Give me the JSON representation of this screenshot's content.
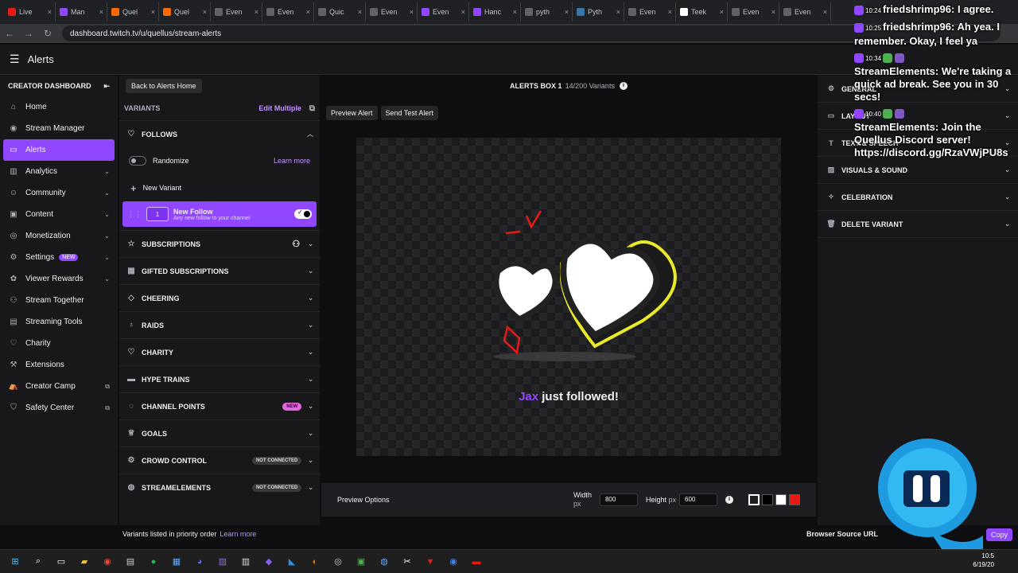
{
  "browser": {
    "tabs": [
      "Live",
      "Man",
      "Quel",
      "Quel",
      "Even",
      "Even",
      "Quic",
      "Even",
      "Even",
      "Hanc",
      "pyth",
      "Pyth",
      "Even",
      "Teek",
      "Even",
      "Even"
    ],
    "url": "dashboard.twitch.tv/u/quellus/stream-alerts"
  },
  "header": {
    "title": "Alerts"
  },
  "sidebar": {
    "heading": "CREATOR DASHBOARD",
    "items": [
      {
        "label": "Home",
        "icon": "⌂"
      },
      {
        "label": "Stream Manager",
        "icon": "◉"
      },
      {
        "label": "Alerts",
        "icon": "▭",
        "active": true
      },
      {
        "label": "Analytics",
        "icon": "▥",
        "chevron": true
      },
      {
        "label": "Community",
        "icon": "☺",
        "chevron": true
      },
      {
        "label": "Content",
        "icon": "▣",
        "chevron": true
      },
      {
        "label": "Monetization",
        "icon": "◎",
        "chevron": true
      },
      {
        "label": "Settings",
        "icon": "⚙",
        "chevron": true,
        "badge": "NEW"
      },
      {
        "label": "Viewer Rewards",
        "icon": "✿",
        "chevron": true
      },
      {
        "label": "Stream Together",
        "icon": "⚇"
      },
      {
        "label": "Streaming Tools",
        "icon": "▤"
      },
      {
        "label": "Charity",
        "icon": "♡"
      },
      {
        "label": "Extensions",
        "icon": "⚒"
      },
      {
        "label": "Creator Camp",
        "icon": "⛺",
        "external": true
      },
      {
        "label": "Safety Center",
        "icon": "⛉",
        "external": true
      }
    ]
  },
  "variants": {
    "back_label": "Back to Alerts Home",
    "label": "VARIANTS",
    "edit_multiple": "Edit Multiple",
    "follows": "FOLLOWS",
    "randomize": "Randomize",
    "learn_more": "Learn more",
    "new_variant": "New Variant",
    "card": {
      "number": "1",
      "title": "New Follow",
      "subtitle": "Any new follow to your channel"
    },
    "categories": [
      {
        "label": "SUBSCRIPTIONS",
        "icon": "☆"
      },
      {
        "label": "GIFTED SUBSCRIPTIONS",
        "icon": "▦"
      },
      {
        "label": "CHEERING",
        "icon": "◇"
      },
      {
        "label": "RAIDS",
        "icon": "♁"
      },
      {
        "label": "CHARITY",
        "icon": "♡"
      },
      {
        "label": "HYPE TRAINS",
        "icon": "▬"
      },
      {
        "label": "CHANNEL POINTS",
        "icon": "◌",
        "pill": "NEW"
      },
      {
        "label": "GOALS",
        "icon": "♕"
      },
      {
        "label": "CROWD CONTROL",
        "icon": "⚙",
        "pill": "NOT CONNECTED"
      },
      {
        "label": "STREAMELEMENTS",
        "icon": "◍",
        "pill": "NOT CONNECTED"
      }
    ],
    "footer": "Variants listed in priority order",
    "footer_link": "Learn more"
  },
  "center": {
    "box_title": "ALERTS BOX 1",
    "box_count": "14/200 Variants",
    "preview_alert": "Preview Alert",
    "send_test": "Send Test Alert",
    "alert_user": "Jax",
    "alert_text": "just followed!",
    "preview_options": "Preview Options",
    "width_label": "Width",
    "width_unit": "px",
    "width_value": "800",
    "height_label": "Height",
    "height_unit": "px",
    "height_value": "600",
    "swatches": [
      "#1f1f23",
      "#000000",
      "#ffffff",
      "#e91916"
    ]
  },
  "right": {
    "sections": [
      {
        "label": "GENERAL",
        "icon": "⚙"
      },
      {
        "label": "LAYOUT",
        "icon": "▭"
      },
      {
        "label": "TEXT & SPEECH",
        "icon": "T"
      },
      {
        "label": "VISUALS & SOUND",
        "icon": "▨"
      },
      {
        "label": "CELEBRATION",
        "icon": "✧"
      },
      {
        "label": "DELETE VARIANT",
        "icon": "🗑"
      }
    ],
    "browser_source": "Browser Source URL",
    "copy": "Copy"
  },
  "chat": [
    {
      "time": "10:24",
      "user": "friedshrimp96:",
      "msg": "I agree."
    },
    {
      "time": "10:25",
      "user": "friedshrimp96:",
      "msg": "Ah yea. I remember. Okay, I feel ya"
    },
    {
      "time": "10:34",
      "user": "StreamElements:",
      "msg": "We're taking a quick ad break. See you in 30 secs!"
    },
    {
      "time": "10:40",
      "user": "StreamElements:",
      "msg": "Join the Quellus Discord server! https://discord.gg/RzaVWjPU8s"
    }
  ],
  "taskbar": {
    "time": "10:5",
    "date": "6/19/20"
  },
  "colors": {
    "accent": "#9147ff",
    "bg": "#0e0e10",
    "panel": "#18181b"
  }
}
